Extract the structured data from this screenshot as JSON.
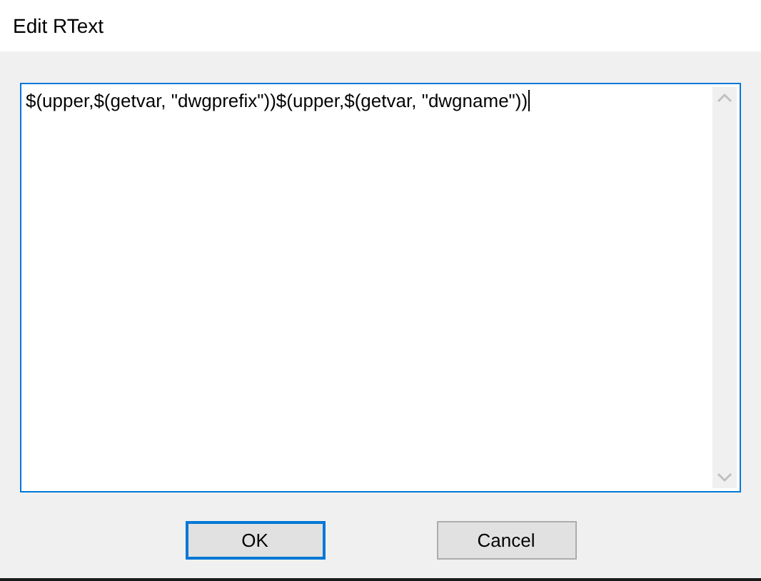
{
  "window": {
    "title": "Edit RText"
  },
  "editor": {
    "value": "$(upper,$(getvar, \"dwgprefix\"))$(upper,$(getvar, \"dwgname\"))",
    "focused": true
  },
  "buttons": [
    {
      "label": "OK",
      "default": true
    },
    {
      "label": "Cancel",
      "default": false
    }
  ]
}
